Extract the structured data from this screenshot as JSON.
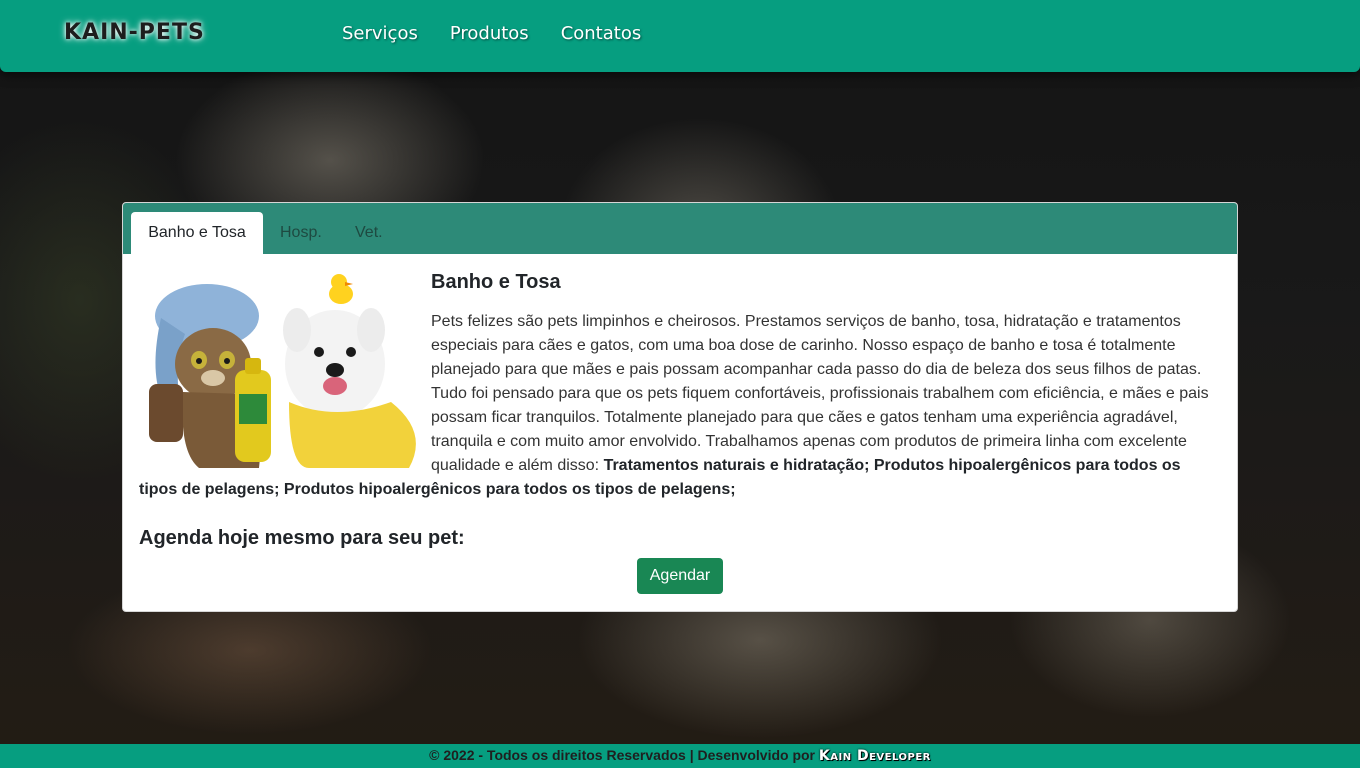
{
  "navbar": {
    "brand": "KAIN-PETS",
    "links": [
      "Serviços",
      "Produtos",
      "Contatos"
    ]
  },
  "tabs": [
    "Banho e Tosa",
    "Hosp.",
    "Vet."
  ],
  "service": {
    "title": "Banho e Tosa",
    "text": "Pets felizes são pets limpinhos e cheirosos. Prestamos serviços de banho, tosa, hidratação e tratamentos especiais para cães e gatos, com uma boa dose de carinho. Nosso espaço de banho e tosa é totalmente planejado para que mães e pais possam acompanhar cada passo do dia de beleza dos seus filhos de patas. Tudo foi pensado para que os pets fiquem confortáveis, profissionais trabalhem com eficiência, e mães e pais possam ficar tranquilos. Totalmente planejado para que cães e gatos tenham uma experiência agradável, tranquila e com muito amor envolvido. Trabalhamos apenas com produtos de primeira linha com excelente qualidade e além disso: ",
    "highlights": "Tratamentos naturais e hidratação; Produtos hipoalergênicos para todos os tipos de pelagens; Produtos hipoalergênicos para todos os tipos de pelagens;",
    "cta_title": "Agenda hoje mesmo para seu pet:",
    "cta_button": "Agendar"
  },
  "footer": {
    "text": "© 2022 - Todos os direitos Reservados | Desenvolvido por ",
    "brand": "Kain Developer"
  },
  "colors": {
    "primary": "#069e80",
    "tab_bar": "#2d8a78",
    "button": "#198754"
  }
}
